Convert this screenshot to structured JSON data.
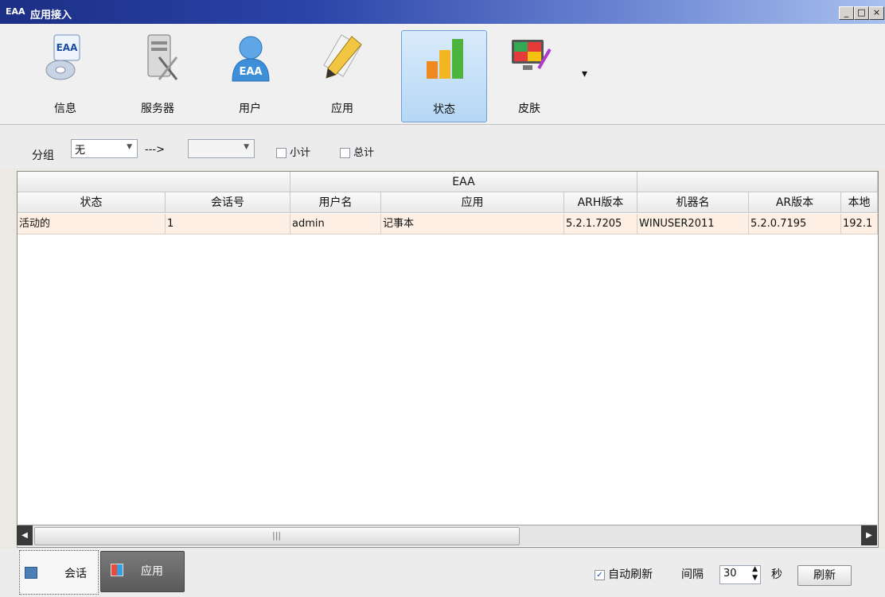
{
  "window": {
    "title": "应用接入",
    "app_icon_text": "EAA",
    "min_glyph": "_",
    "max_glyph": "□",
    "close_glyph": "×"
  },
  "toolbar": {
    "items": [
      {
        "label": "信息",
        "icon": "info-icon"
      },
      {
        "label": "服务器",
        "icon": "server-icon"
      },
      {
        "label": "用户",
        "icon": "user-icon",
        "icon_text": "EAA"
      },
      {
        "label": "应用",
        "icon": "pencil-icon"
      },
      {
        "label": "状态",
        "icon": "bar-chart-icon",
        "active": true
      },
      {
        "label": "皮肤",
        "icon": "skin-palette-icon"
      }
    ],
    "more_glyph": "▾"
  },
  "filter": {
    "group_label": "分组",
    "group_value": "无",
    "arrow": "--->",
    "second_value": "",
    "subtotal_label": "小计",
    "total_label": "总计",
    "subtotal_checked": false,
    "total_checked": false
  },
  "grid": {
    "band_header": "EAA",
    "columns": [
      "状态",
      "会话号",
      "用户名",
      "应用",
      "ARH版本",
      "机器名",
      "AR版本",
      "本地"
    ],
    "rows": [
      [
        "活动的",
        "1",
        "admin",
        "记事本",
        "5.2.1.7205",
        "WINUSER2011",
        "5.2.0.7195",
        "192.1"
      ]
    ]
  },
  "bottom": {
    "tab_session": "会话",
    "tab_app": "应用",
    "auto_refresh_label": "自动刷新",
    "auto_refresh_checked": true,
    "interval_label": "间隔",
    "interval_value": "30",
    "seconds_label": "秒",
    "refresh_button": "刷新"
  },
  "colors": {
    "titlebar": "#1c2f86",
    "row_highlight": "#fdefe3",
    "active_tab": "#6e6e6e"
  }
}
